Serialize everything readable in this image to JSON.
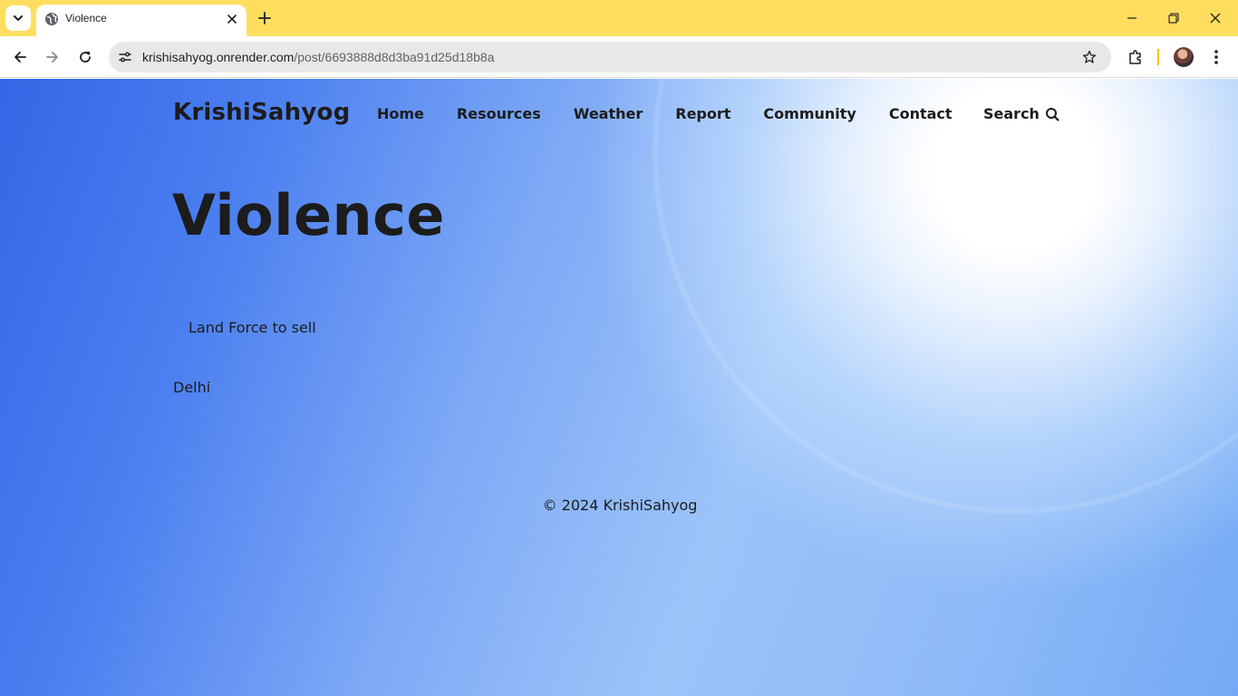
{
  "browser": {
    "tab": {
      "title": "Violence"
    },
    "address_bar": {
      "host": "krishisahyog.onrender.com",
      "path": "/post/6693888d8d3ba91d25d18b8a"
    }
  },
  "site": {
    "brand": "KrishiSahyog",
    "nav": [
      {
        "label": "Home"
      },
      {
        "label": "Resources"
      },
      {
        "label": "Weather"
      },
      {
        "label": "Report"
      },
      {
        "label": "Community"
      },
      {
        "label": "Contact"
      }
    ],
    "search_label": "Search"
  },
  "post": {
    "title": "Violence",
    "body": "Land Force to sell",
    "location": "Delhi"
  },
  "footer": {
    "text": "© 2024 KrishiSahyog"
  },
  "colors": {
    "tab_strip": "#ffde5f",
    "text": "#1c1c1c",
    "page_gradient_start": "#3566e6",
    "page_gradient_end": "#74aaf5"
  }
}
